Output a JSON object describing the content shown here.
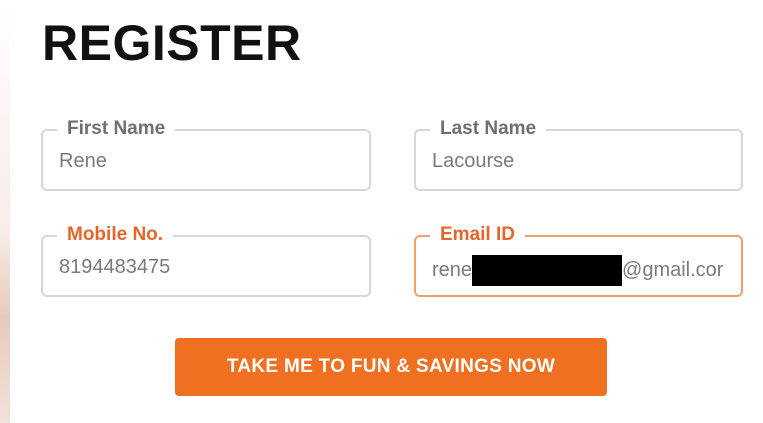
{
  "form": {
    "title": "REGISTER",
    "fields": {
      "first_name": {
        "label": "First Name",
        "value": "Rene"
      },
      "last_name": {
        "label": "Last Name",
        "value": "Lacourse"
      },
      "mobile": {
        "label": "Mobile No.",
        "value": "8194483475"
      },
      "email": {
        "label": "Email ID",
        "value_prefix": "rene",
        "value_suffix": "@gmail.cor"
      }
    },
    "submit_label": "TAKE ME TO FUN & SAVINGS NOW"
  },
  "colors": {
    "accent": "#f07022",
    "active_label": "#e8652a",
    "active_border": "#f0a169"
  }
}
